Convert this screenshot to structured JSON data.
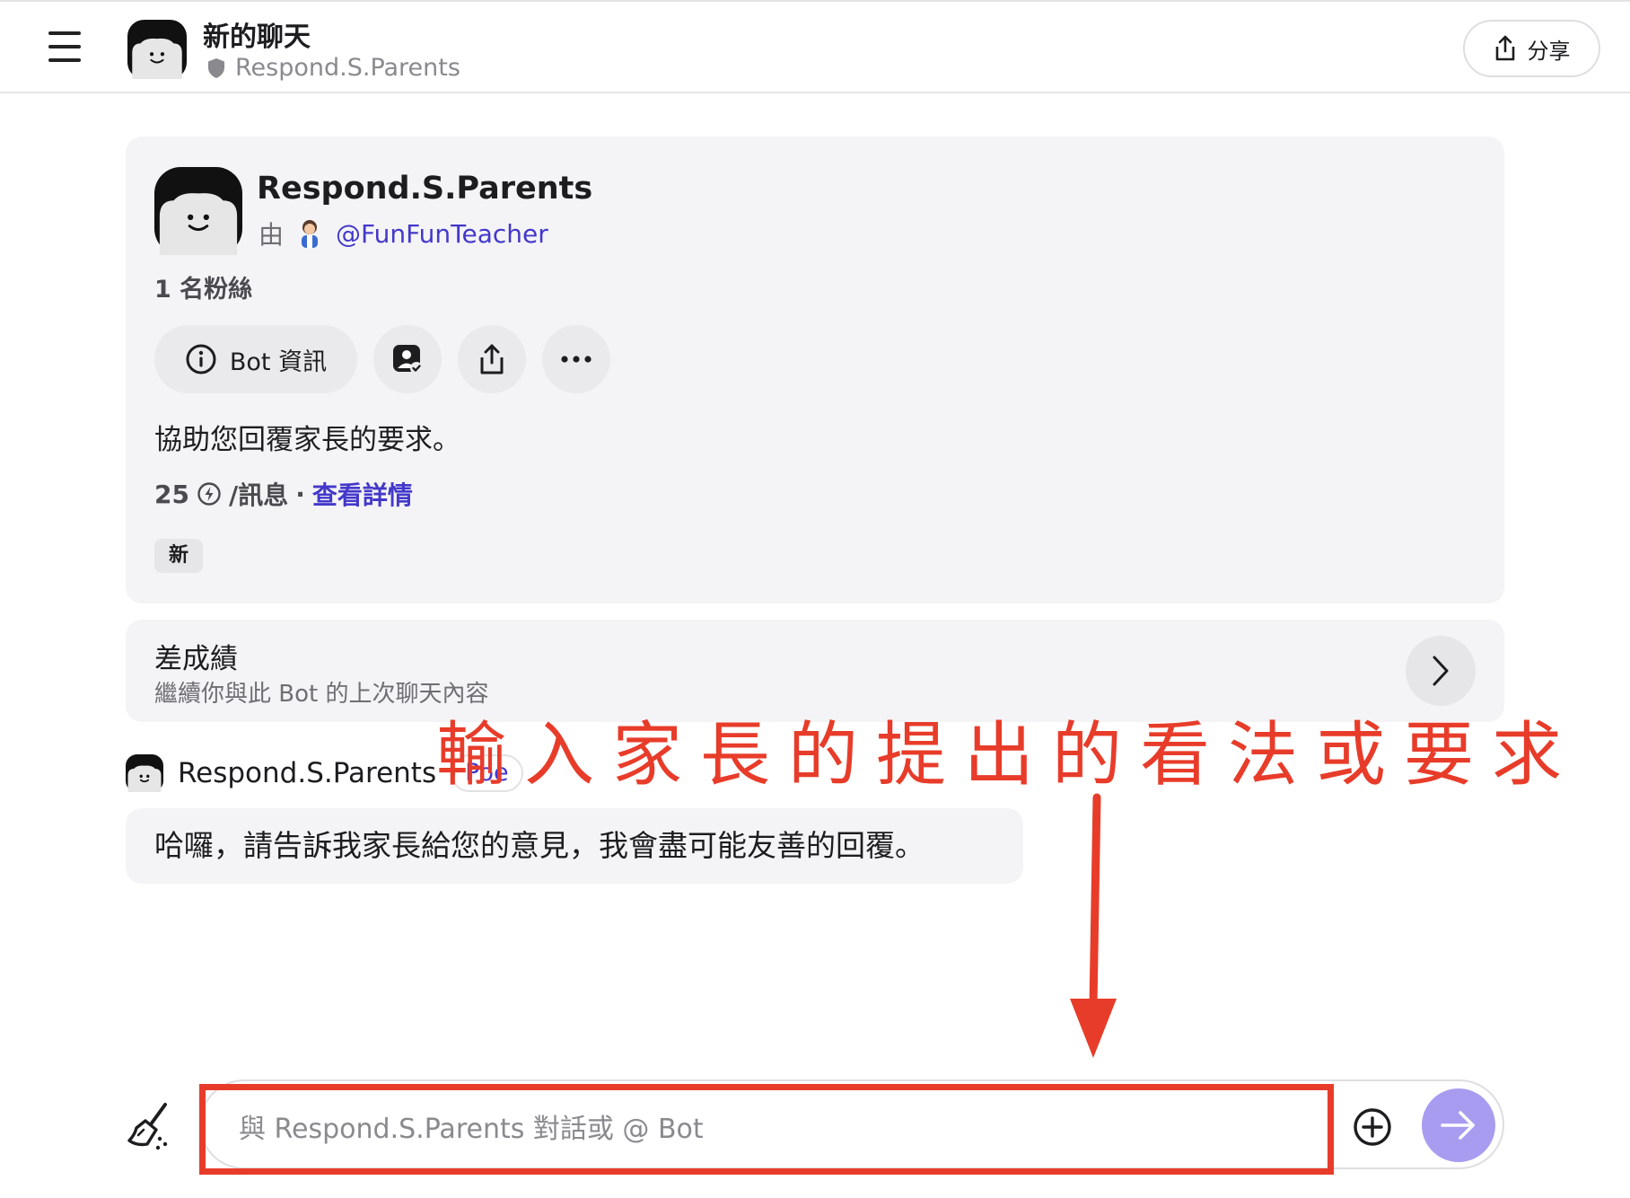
{
  "header": {
    "title": "新的聊天",
    "bot_name": "Respond.S.Parents",
    "share_label": "分享"
  },
  "bot_card": {
    "name": "Respond.S.Parents",
    "by_label": "由",
    "creator": "@FunFunTeacher",
    "followers": "1 名粉絲",
    "info_button": "Bot 資訊",
    "description": "協助您回覆家長的要求。",
    "price_value": "25",
    "price_unit": "/訊息",
    "price_separator": "·",
    "details_link": "查看詳情",
    "tag": "新"
  },
  "previous_chat": {
    "title": "差成績",
    "subtitle": "繼續你與此 Bot 的上次聊天內容"
  },
  "message": {
    "sender": "Respond.S.Parents",
    "badge": "Poe",
    "text": "哈囉，請告訴我家長給您的意見，我會盡可能友善的回覆。"
  },
  "annotation": {
    "text": "輸入家長的提出的看法或要求"
  },
  "composer": {
    "placeholder": "與 Respond.S.Parents 對話或 @ Bot",
    "value": ""
  },
  "colors": {
    "accent": "#4338ca",
    "send_button": "#a79cf0",
    "annotation_red": "#e83c2a",
    "card_bg": "#f4f4f6"
  },
  "icons": {
    "menu": "hamburger-icon",
    "shield": "shield-icon",
    "share": "share-icon",
    "info": "info-icon",
    "profile": "profile-check-icon",
    "more": "ellipsis-icon",
    "chevron": "chevron-right-icon",
    "broom": "broom-icon",
    "attach": "plus-circle-icon",
    "send": "arrow-right-icon"
  }
}
